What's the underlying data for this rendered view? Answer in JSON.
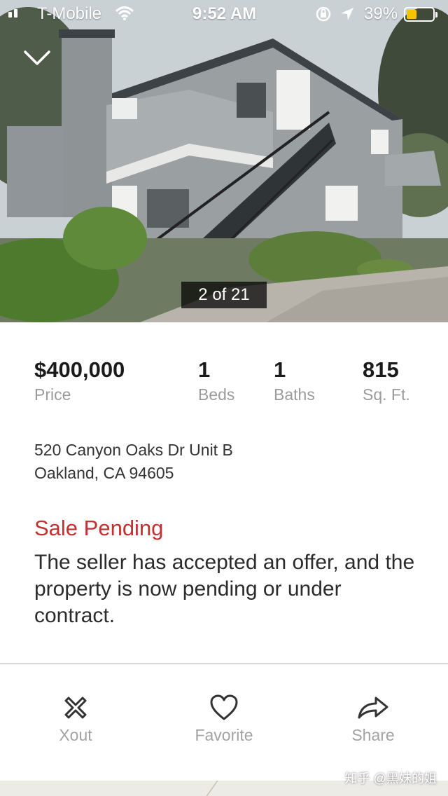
{
  "status_bar": {
    "carrier": "T-Mobile",
    "time": "9:52 AM",
    "battery_percent": "39%",
    "battery_level": 0.39,
    "icons": [
      "signal-icon",
      "wifi-icon",
      "orientation-lock-icon",
      "location-arrow-icon",
      "battery-icon"
    ]
  },
  "gallery": {
    "counter": "2 of 21",
    "current_photo": 2,
    "total_photos": 21
  },
  "listing": {
    "price": {
      "value": "$400,000",
      "label": "Price"
    },
    "beds": {
      "value": "1",
      "label": "Beds"
    },
    "baths": {
      "value": "1",
      "label": "Baths"
    },
    "sqft": {
      "value": "815",
      "label": "Sq. Ft."
    },
    "address_line1": "520 Canyon Oaks Dr Unit B",
    "address_line2": "Oakland, CA 94605",
    "status_title": "Sale Pending",
    "status_description": "The seller has accepted an offer, and the property is now pending or under contract."
  },
  "actions": {
    "xout": "Xout",
    "favorite": "Favorite",
    "share": "Share"
  },
  "watermark": "知乎 @黑妹的姐",
  "colors": {
    "pending_red": "#c42f2f",
    "label_gray": "#9b9b9b",
    "battery_yellow": "#f5c400"
  }
}
